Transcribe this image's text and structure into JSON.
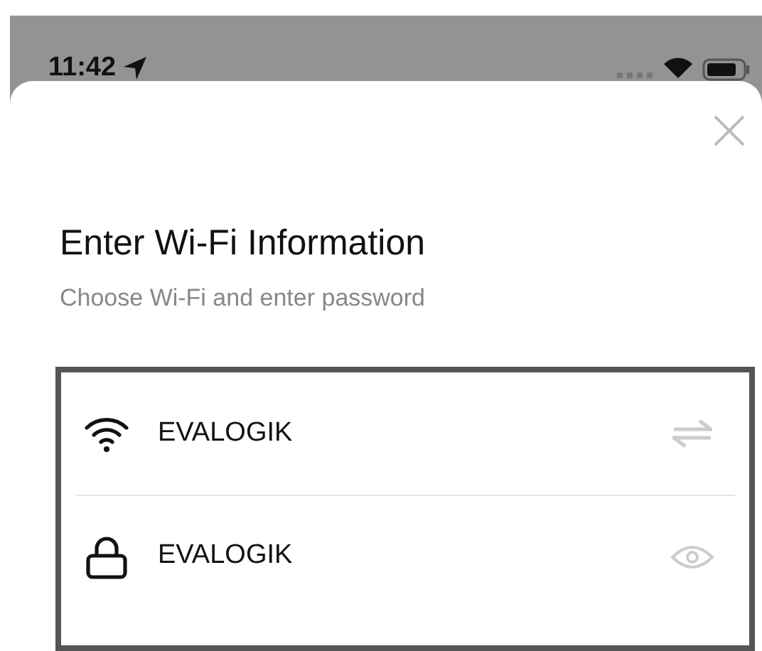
{
  "status_bar": {
    "time": "11:42"
  },
  "sheet": {
    "title": "Enter Wi-Fi Information",
    "subtitle": "Choose Wi-Fi and enter password",
    "fields": [
      {
        "kind": "network",
        "value": "EVALOGIK"
      },
      {
        "kind": "password",
        "value": "EVALOGIK"
      }
    ]
  }
}
